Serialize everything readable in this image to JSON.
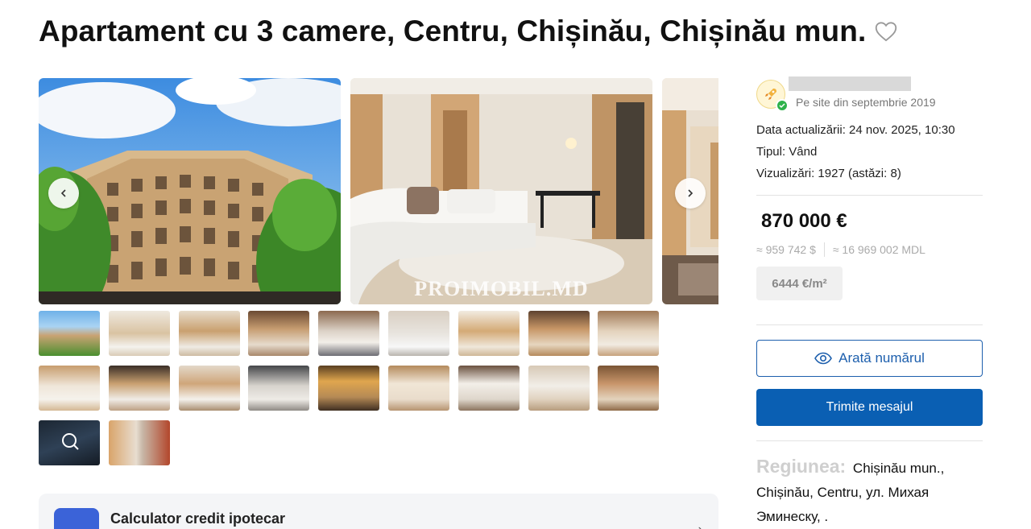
{
  "listing": {
    "title": "Apartament cu 3 camere, Centru, Chișinău, Chișinău mun.",
    "favorite_icon": "heart-outline-icon"
  },
  "gallery": {
    "watermark": "PROIMOBIL.MD",
    "prev_icon": "chevron-left-icon",
    "next_icon": "chevron-right-icon"
  },
  "seller": {
    "since": "Pe site din septembrie 2019"
  },
  "details": {
    "updated": "Data actualizării: 24 nov. 2025, 10:30",
    "type": "Tipul: Vând",
    "views": "Vizualizări: 1927 (astăzi: 8)"
  },
  "price": {
    "main": "870 000 €",
    "usd": "≈ 959 742 $",
    "mdl": "≈ 16 969 002 MDL",
    "per_sqm": "6444 €/m²"
  },
  "actions": {
    "show_number": "Arată numărul",
    "send_message": "Trimite mesajul"
  },
  "region": {
    "label": "Regiunea:",
    "value": "Chișinău mun., Chișinău, Centru, ул. Михая Эминеску, ."
  },
  "calculator": {
    "label": "Calculator credit ipotecar"
  },
  "colors": {
    "primary_button": "#0a5fb3",
    "outline_button": "#1d5fad",
    "verified_badge": "#2eb24b"
  }
}
